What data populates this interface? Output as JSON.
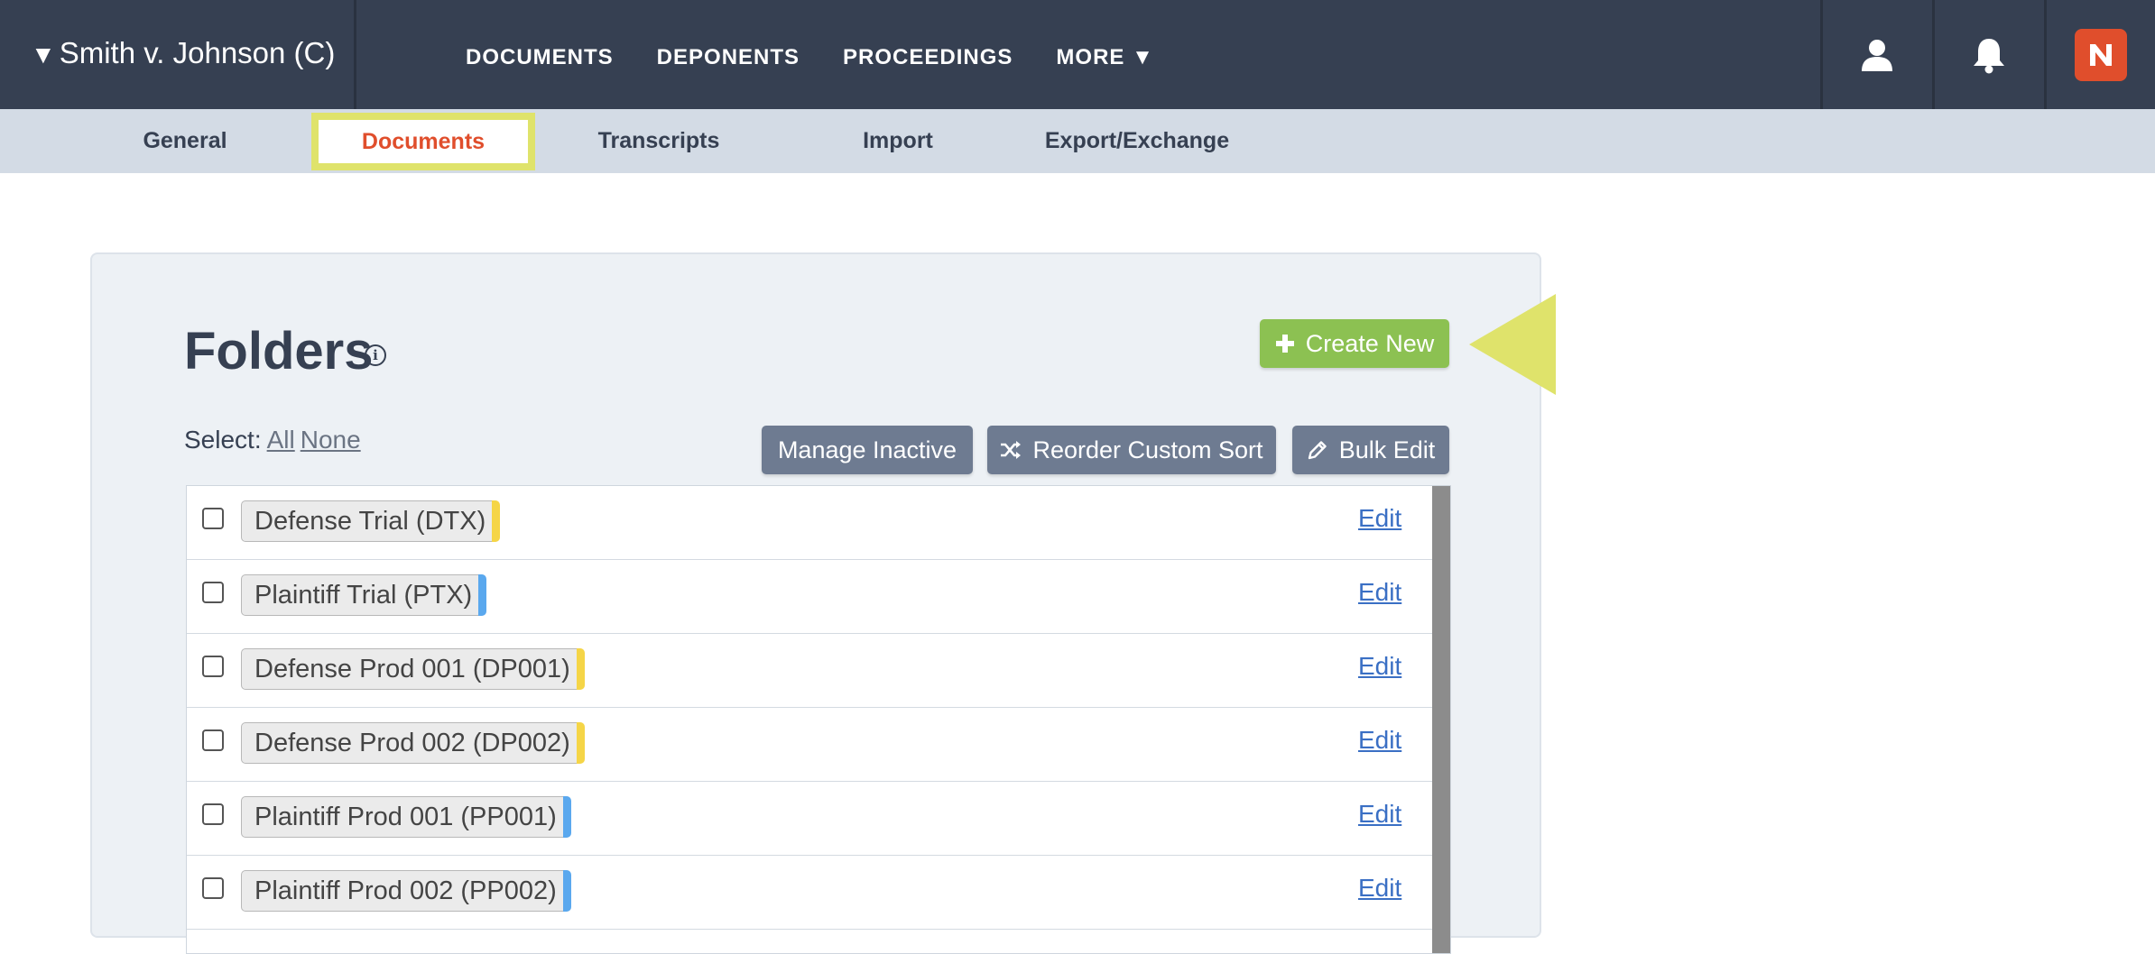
{
  "topbar": {
    "case_title": "Smith v. Johnson (C)",
    "nav": [
      "DOCUMENTS",
      "DEPONENTS",
      "PROCEEDINGS",
      "MORE ▼"
    ],
    "icons": [
      "user-icon",
      "bell-icon",
      "brand-logo-icon"
    ]
  },
  "subnav": {
    "items": [
      "General",
      "Documents",
      "Transcripts",
      "Import",
      "Export/Exchange"
    ],
    "active": "Documents"
  },
  "panel": {
    "title": "Folders",
    "info_glyph": "i",
    "create_label": "Create New",
    "select_label": "Select:",
    "select_all": "All",
    "select_none": "None",
    "manage_inactive_label": "Manage Inactive",
    "reorder_label": "Reorder Custom Sort",
    "bulk_edit_label": "Bulk Edit"
  },
  "folders": [
    {
      "name": "Defense Trial (DTX)",
      "color": "#f5d547",
      "edit": "Edit"
    },
    {
      "name": "Plaintiff Trial (PTX)",
      "color": "#5aa8ee",
      "edit": "Edit"
    },
    {
      "name": "Defense Prod 001 (DP001)",
      "color": "#f5d547",
      "edit": "Edit"
    },
    {
      "name": "Defense Prod 002 (DP002)",
      "color": "#f5d547",
      "edit": "Edit"
    },
    {
      "name": "Plaintiff Prod 001 (PP001)",
      "color": "#5aa8ee",
      "edit": "Edit"
    },
    {
      "name": "Plaintiff Prod 002 (PP002)",
      "color": "#5aa8ee",
      "edit": "Edit"
    }
  ],
  "colors": {
    "topbar": "#364052",
    "accent_active": "#e04e2c",
    "highlight": "#dfe36b",
    "create_green": "#8cc152",
    "gray_button": "#6e7b91"
  }
}
